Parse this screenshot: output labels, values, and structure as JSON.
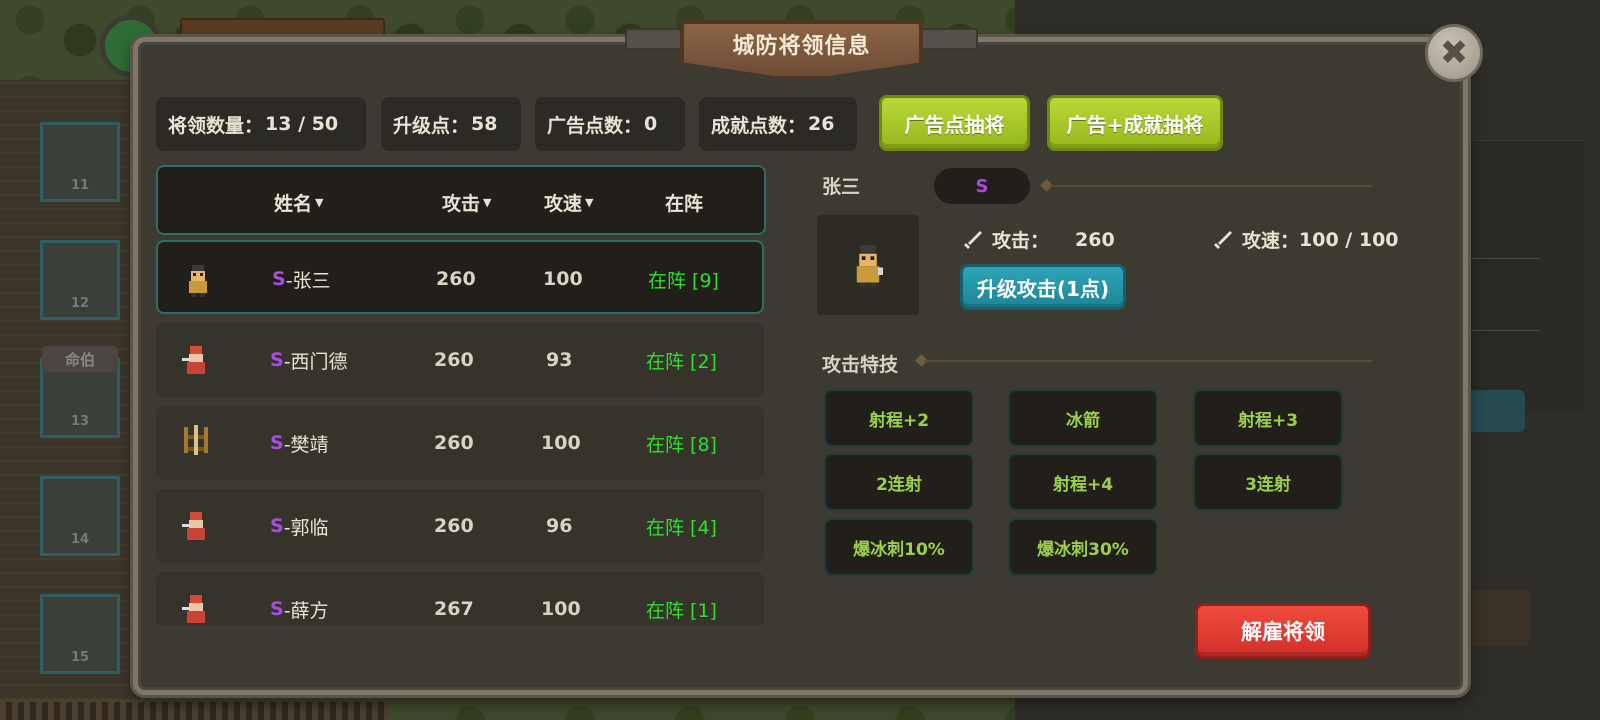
{
  "background": {
    "slots": [
      "11",
      "12",
      "13",
      "14",
      "15"
    ],
    "slot_tag": "命伯"
  },
  "dialog": {
    "title": "城防将领信息",
    "close_glyph": "✖"
  },
  "stats": {
    "general_count_label": "将领数量：",
    "general_count_value": "13 / 50",
    "upgrade_points_label": "升级点：",
    "upgrade_points_value": "58",
    "ad_points_label": "广告点数：",
    "ad_points_value": "0",
    "achievement_points_label": "成就点数：",
    "achievement_points_value": "26"
  },
  "buttons": {
    "ad_draw": "广告点抽将",
    "ad_achievement_draw": "广告+成就抽将",
    "upgrade_attack": "升级攻击(1点)",
    "dismiss": "解雇将领"
  },
  "table": {
    "headers": {
      "name": "姓名",
      "attack": "攻击",
      "speed": "攻速",
      "deployed": "在阵"
    },
    "sort_glyph": "▼",
    "rows": [
      {
        "rank": "S",
        "name": "-张三",
        "attack": "260",
        "speed": "100",
        "status": "在阵 [9]",
        "avatar": "soldier-yellow"
      },
      {
        "rank": "S",
        "name": "-西门德",
        "attack": "260",
        "speed": "93",
        "status": "在阵 [2]",
        "avatar": "soldier-red"
      },
      {
        "rank": "S",
        "name": "-樊靖",
        "attack": "260",
        "speed": "100",
        "status": "在阵 [8]",
        "avatar": "ballista"
      },
      {
        "rank": "S",
        "name": "-郭临",
        "attack": "260",
        "speed": "96",
        "status": "在阵 [4]",
        "avatar": "soldier-red"
      },
      {
        "rank": "S",
        "name": "-薛方",
        "attack": "267",
        "speed": "100",
        "status": "在阵 [1]",
        "avatar": "soldier-red"
      }
    ]
  },
  "detail": {
    "name": "张三",
    "rank": "S",
    "attack_label": "攻击：",
    "attack_value": "260",
    "speed_label": "攻速：",
    "speed_value": "100 / 100",
    "skills_title": "攻击特技",
    "skills": [
      "射程+2",
      "冰箭",
      "射程+3",
      "2连射",
      "射程+4",
      "3连射",
      "爆冰刺10%",
      "爆冰刺30%"
    ]
  },
  "colors": {
    "rank": "#a64ee0",
    "deployed": "#2ee02e",
    "skill_text": "#9bd14a",
    "accent_teal": "#2c6d68",
    "green_button": "#a6c92a",
    "red_button": "#e03c33",
    "blue_button": "#2593a7"
  }
}
